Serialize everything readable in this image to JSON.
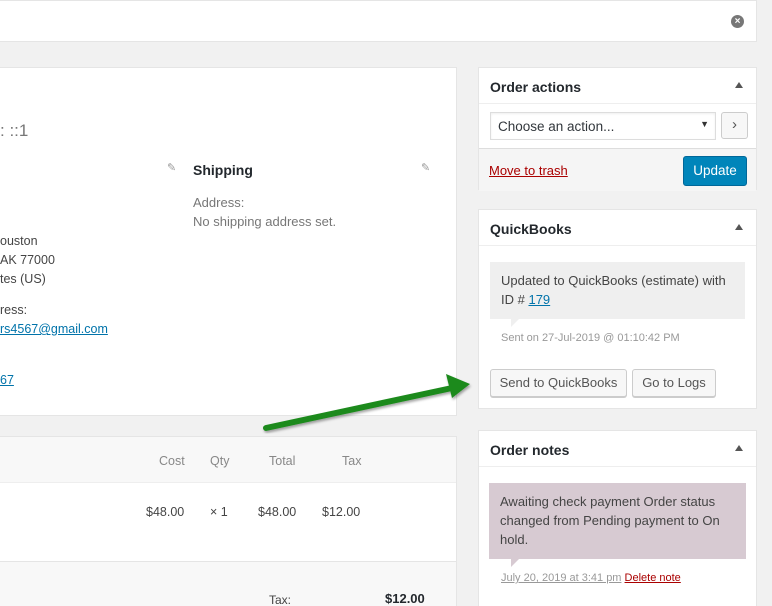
{
  "topbar": {
    "close_icon": "close-circle-icon"
  },
  "order": {
    "heading_fragment": ": ::1",
    "shipping": {
      "title": "Shipping",
      "address_label": "Address:",
      "address_value": "No shipping address set."
    },
    "billing": {
      "line1": "ouston",
      "line2": "AK 77000",
      "line3": "tes (US)",
      "email_label": "ress:",
      "email": "rs4567@gmail.com",
      "phone": "67"
    }
  },
  "items": {
    "columns": [
      "Cost",
      "Qty",
      "Total",
      "Tax"
    ],
    "row": {
      "cost": "$48.00",
      "qty": "× 1",
      "total": "$48.00",
      "tax": "$12.00"
    },
    "tax_label": "Tax:",
    "tax_total": "$12.00"
  },
  "order_actions": {
    "title": "Order actions",
    "select_value": "Choose an action...",
    "go_label": "›",
    "trash_label": "Move to trash",
    "update_label": "Update"
  },
  "quickbooks": {
    "title": "QuickBooks",
    "note_text": "Updated to QuickBooks (estimate) with ID # ",
    "note_id": "179",
    "meta": "Sent on 27-Jul-2019 @ 01:10:42 PM",
    "send_label": "Send to QuickBooks",
    "logs_label": "Go to Logs"
  },
  "order_notes": {
    "title": "Order notes",
    "note_text": "Awaiting check payment Order status changed from Pending payment to On hold.",
    "date": "July 20, 2019 at 3:41 pm",
    "delete_label": "Delete note"
  },
  "colors": {
    "primary_button": "#0085ba",
    "trash_link": "#a00",
    "arrow": "#1f8a1f",
    "note_purple": "#d7cad2"
  }
}
